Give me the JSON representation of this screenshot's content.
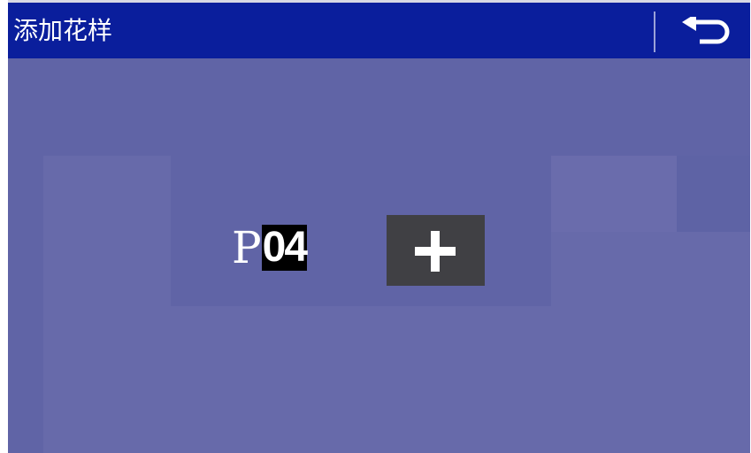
{
  "header": {
    "title": "添加花样",
    "back_icon": "back-arrow-icon"
  },
  "pattern": {
    "prefix": "P",
    "number": "04"
  },
  "add_button": {
    "icon": "plus-icon"
  },
  "colors": {
    "header_bg": "#0a1e9c",
    "screen_bg": "#6468a8",
    "add_button_bg": "#404044",
    "number_highlight": "#000000"
  }
}
